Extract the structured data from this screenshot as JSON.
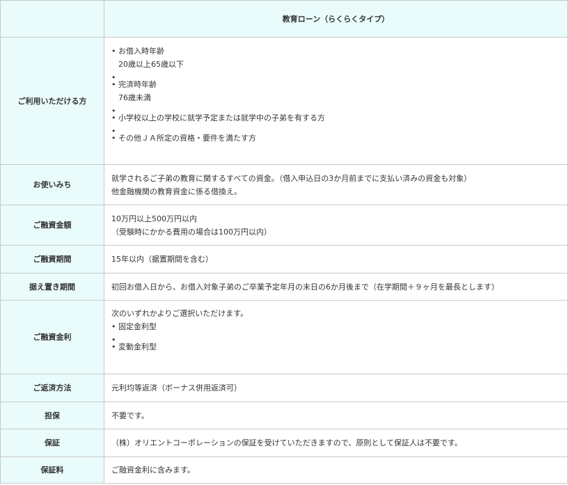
{
  "title": "教育ローン（らくらくタイプ）",
  "rows": {
    "eligible": {
      "label": "ご利用いただける方",
      "item1": "お借入時年齢",
      "item1_sub": "20歳以上65歳以下",
      "item2": "完済時年齢",
      "item2_sub": "76歳未満",
      "item3": "小学校以上の学校に就学予定または就学中の子弟を有する方",
      "item4": "その他ＪＡ所定の資格・要件を満たす方"
    },
    "usage": {
      "label": "お使いみち",
      "line1": "就学されるご子弟の教育に関するすべての資金。（借入申込日の3か月前までに支払い済みの資金も対象）",
      "line2": "他金融機関の教育資金に係る借換え。"
    },
    "amount": {
      "label": "ご融資金額",
      "line1": "10万円以上500万円以内",
      "line2": "（受験時にかかる費用の場合は100万円以内）"
    },
    "term": {
      "label": "ご融資期間",
      "value": "15年以内（据置期間を含む）"
    },
    "deferment": {
      "label": "据え置き期間",
      "value": "初回お借入日から、お借入対象子弟のご卒業予定年月の末日の6か月後まで（在学期間＋９ヶ月を最長とします）"
    },
    "rate": {
      "label": "ご融資金利",
      "intro": "次のいずれかよりご選択いただけます。",
      "opt1": "固定金利型",
      "opt2": "変動金利型"
    },
    "repayment": {
      "label": "ご返済方法",
      "value": "元利均等返済（ボーナス併用返済可）"
    },
    "collateral": {
      "label": "担保",
      "value": "不要です。"
    },
    "guarantee": {
      "label": "保証",
      "value": "（株）オリエントコーポレーションの保証を受けていただきますので、原則として保証人は不要です。"
    },
    "fee": {
      "label": "保証料",
      "value": "ご融資金利に含みます。"
    }
  }
}
